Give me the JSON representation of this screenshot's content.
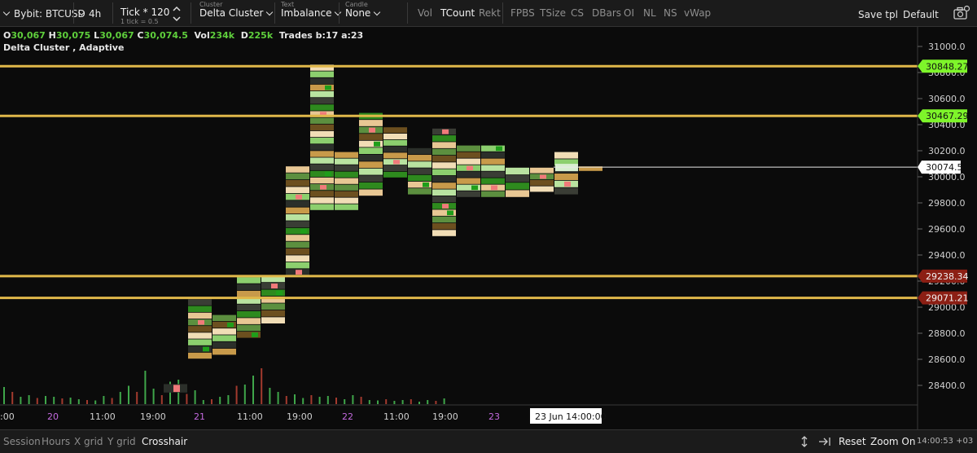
{
  "toolbar": {
    "symbol": "Bybit: BTCUSD",
    "timeframe": "4h",
    "tick_label": "Tick * 120",
    "tick_sub": "1 tick = 0.5",
    "cluster_caption": "Cluster",
    "cluster_value": "Delta Cluster",
    "text_caption": "Text",
    "text_value": "Imbalance",
    "candle_caption": "Candle",
    "candle_value": "None",
    "toggles": [
      {
        "label": "Vol",
        "active": false
      },
      {
        "label": "TCount",
        "active": true
      },
      {
        "label": "Rekt",
        "active": false
      },
      {
        "label": "FPBS",
        "active": false
      },
      {
        "label": "TSize",
        "active": false
      },
      {
        "label": "CS",
        "active": false
      },
      {
        "label": "DBars",
        "active": false
      },
      {
        "label": "OI",
        "active": false
      },
      {
        "label": "NL",
        "active": false
      },
      {
        "label": "NS",
        "active": false
      },
      {
        "label": "vWap",
        "active": false
      }
    ],
    "save_tpl": "Save tpl",
    "default": "Default"
  },
  "legend": {
    "o_key": "O",
    "o_val": "30,067",
    "h_key": "H",
    "h_val": "30,075",
    "l_key": "L",
    "l_val": "30,067",
    "c_key": "C",
    "c_val": "30,074.5",
    "vol_key": "Vol",
    "vol_val": "234k",
    "d_key": "D",
    "d_val": "225k",
    "trades": "Trades b:17 a:23",
    "indicator": "Delta Cluster , Adaptive"
  },
  "chart_data": {
    "type": "table",
    "price_axis": {
      "ticks": [
        "31000.0",
        "30800.0",
        "30600.0",
        "30400.0",
        "30200.0",
        "30000.0",
        "29800.0",
        "29600.0",
        "29400.0",
        "29200.0",
        "29000.0",
        "28800.0",
        "28600.0",
        "28400.0"
      ],
      "range": [
        28300,
        31100
      ]
    },
    "time_axis": {
      "labels": [
        {
          "text": ":00",
          "highlight": false
        },
        {
          "text": "20",
          "highlight": true
        },
        {
          "text": "11:00",
          "highlight": false
        },
        {
          "text": "19:00",
          "highlight": false
        },
        {
          "text": "21",
          "highlight": true
        },
        {
          "text": "11:00",
          "highlight": false
        },
        {
          "text": "19:00",
          "highlight": false
        },
        {
          "text": "22",
          "highlight": true
        },
        {
          "text": "11:00",
          "highlight": false
        },
        {
          "text": "19:00",
          "highlight": false
        },
        {
          "text": "23",
          "highlight": true
        }
      ],
      "crosshair_time": "23 Jun 14:00:00"
    },
    "levels": [
      {
        "price": 30848.27,
        "label": "30848.27",
        "kind": "resistance"
      },
      {
        "price": 30467.29,
        "label": "30467.29",
        "kind": "resistance"
      },
      {
        "price": 29238.34,
        "label": "29238.34",
        "kind": "support"
      },
      {
        "price": 29071.21,
        "label": "29071.21",
        "kind": "support"
      }
    ],
    "last_price": {
      "price": 30074.5,
      "label": "30074.5"
    },
    "clusters": [
      {
        "low": 28340,
        "high": 28410
      },
      {
        "low": 28600,
        "high": 29060
      },
      {
        "low": 28630,
        "high": 28940
      },
      {
        "low": 28760,
        "high": 29230
      },
      {
        "low": 28870,
        "high": 29240
      },
      {
        "low": 29240,
        "high": 30080
      },
      {
        "low": 29740,
        "high": 30860
      },
      {
        "low": 29740,
        "high": 30190
      },
      {
        "low": 29850,
        "high": 30490
      },
      {
        "low": 29990,
        "high": 30380
      },
      {
        "low": 29860,
        "high": 30220
      },
      {
        "low": 29540,
        "high": 30370
      },
      {
        "low": 29840,
        "high": 30240
      },
      {
        "low": 29840,
        "high": 30240
      },
      {
        "low": 29840,
        "high": 30070
      },
      {
        "low": 29880,
        "high": 30070
      },
      {
        "low": 29860,
        "high": 30190
      },
      {
        "low": 30040,
        "high": 30080
      }
    ],
    "volume_heights": [
      0.42,
      0.3,
      0.18,
      0.22,
      0.15,
      0.2,
      0.18,
      0.14,
      0.16,
      0.12,
      0.1,
      0.09,
      0.2,
      0.15,
      0.3,
      0.45,
      0.3,
      0.82,
      0.38,
      0.22,
      0.55,
      0.6,
      0.25,
      0.34,
      0.1,
      0.12,
      0.18,
      0.22,
      0.45,
      0.48,
      0.7,
      0.88,
      0.4,
      0.3,
      0.2,
      0.24,
      0.15,
      0.22,
      0.18,
      0.2,
      0.16,
      0.12,
      0.22,
      0.18,
      0.1,
      0.09,
      0.12,
      0.08,
      0.1,
      0.12,
      0.06,
      0.1,
      0.08,
      0.14
    ]
  },
  "bottombar": {
    "session": "Session",
    "hours": "Hours",
    "xgrid": "X grid",
    "ygrid": "Y grid",
    "crosshair": "Crosshair",
    "reset": "Reset",
    "zoom": "Zoom On",
    "clock": "14:00:53 +03"
  },
  "colors": {
    "level_line": "#e0b84a",
    "resistance_tag": "#7ef52a",
    "support_tag": "#8c1f14",
    "highlight_date": "#c46adf"
  }
}
